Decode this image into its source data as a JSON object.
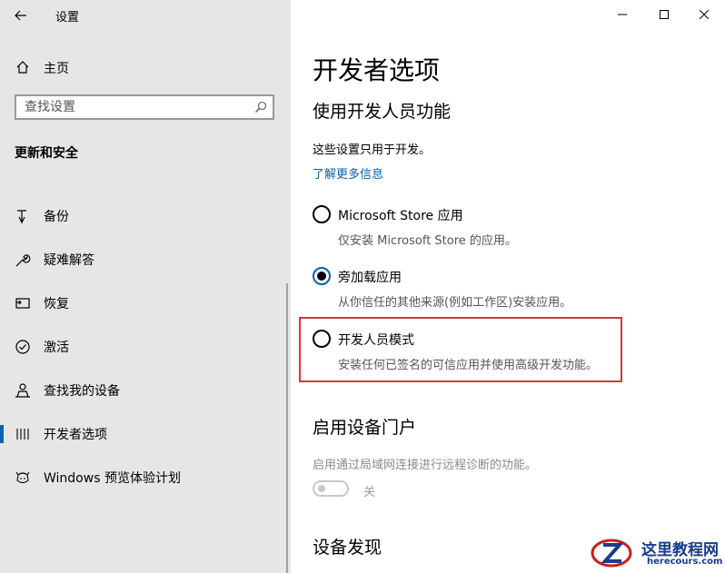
{
  "window": {
    "title": "设置",
    "controls": [
      "minimize-icon",
      "maximize-icon",
      "close-icon"
    ]
  },
  "sidebar": {
    "home_label": "主页",
    "search_placeholder": "查找设置",
    "section_title": "更新和安全",
    "items": [
      {
        "label": "备份",
        "icon": "backup-arrow-icon",
        "selected": false
      },
      {
        "label": "疑难解答",
        "icon": "wrench-icon",
        "selected": false
      },
      {
        "label": "恢复",
        "icon": "recovery-icon",
        "selected": false
      },
      {
        "label": "激活",
        "icon": "check-circle-icon",
        "selected": false
      },
      {
        "label": "查找我的设备",
        "icon": "person-location-icon",
        "selected": false
      },
      {
        "label": "开发者选项",
        "icon": "developer-icon",
        "selected": true
      },
      {
        "label": "Windows 预览体验计划",
        "icon": "insider-icon",
        "selected": false
      }
    ]
  },
  "main": {
    "page_title": "开发者选项",
    "section1_title": "使用开发人员功能",
    "intro_text": "这些设置只用于开发。",
    "learn_more_link": "了解更多信息",
    "options": [
      {
        "label": "Microsoft Store 应用",
        "desc": "仅安装 Microsoft Store 的应用。",
        "selected": false
      },
      {
        "label": "旁加载应用",
        "desc": "从你信任的其他来源(例如工作区)安装应用。",
        "selected": true
      },
      {
        "label": "开发人员模式",
        "desc": "安装任何已签名的可信应用并使用高级开发功能。",
        "selected": false
      }
    ],
    "section2_title": "启用设备门户",
    "section2_desc": "启用通过局域网连接进行远程诊断的功能。",
    "toggle_state_label": "关",
    "toggle_on": false,
    "section3_title": "设备发现"
  },
  "watermark": {
    "title": "这里教程网",
    "url": "herecours.com"
  },
  "colors": {
    "accent": "#0063b1",
    "highlight_border": "#d9363e",
    "sidebar_bg": "#e6e6e6"
  }
}
